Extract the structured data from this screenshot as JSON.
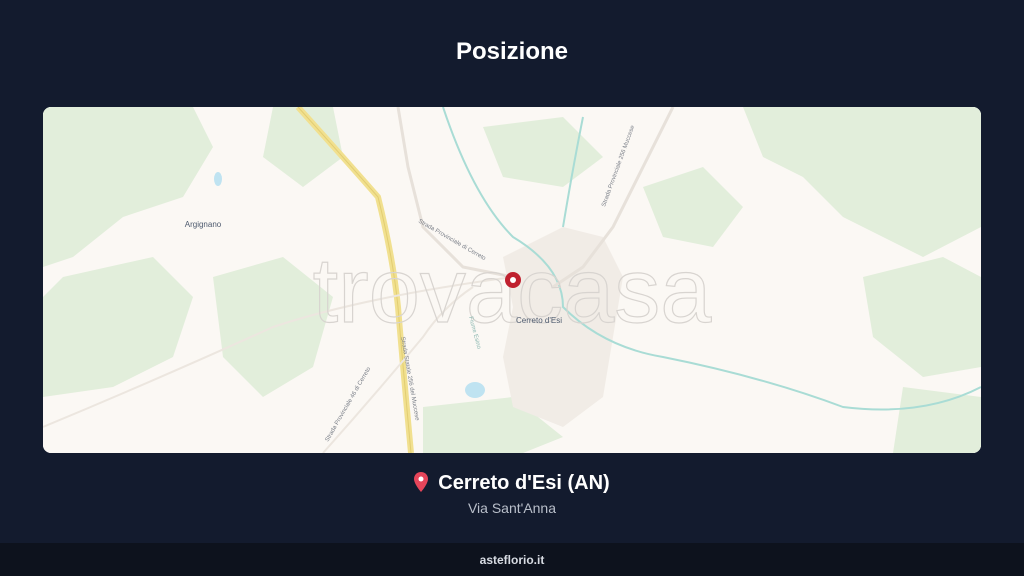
{
  "section": {
    "title": "Posizione"
  },
  "map": {
    "watermark": "trovacasa",
    "labels": {
      "town": "Argignano",
      "city": "Cerreto d'Esi",
      "road_1": "Strada Statale 256 del Muccese",
      "road_2": "Strada Provinciale 46 di Cerreto",
      "road_3": "Strada Provinciale 256 Muccese",
      "road_4": "Fiume Esino",
      "road_5": "Strada Provinciale di Cerreto"
    }
  },
  "location": {
    "icon": "map-pin-icon",
    "name": "Cerreto d'Esi (AN)",
    "address": "Via Sant'Anna"
  },
  "footer": {
    "site": "asteflorio.it"
  }
}
